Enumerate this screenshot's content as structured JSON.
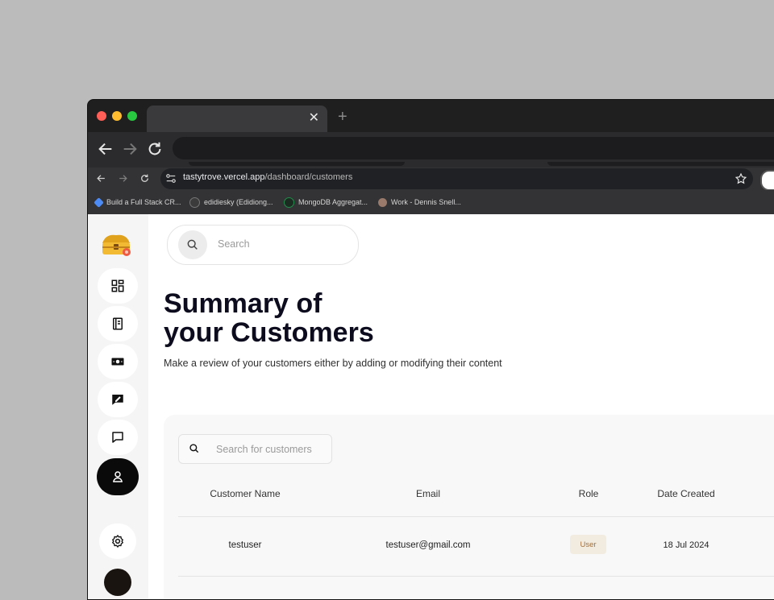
{
  "browser": {
    "tab_close_glyph": "✕",
    "new_tab_glyph": "+",
    "url_host": "tastytrove.vercel.app",
    "url_path": "/dashboard/customers",
    "bookmarks": [
      {
        "label": "Build a Full Stack CR...",
        "icon": "blue-diamond-icon",
        "color": "#4c8bf5"
      },
      {
        "label": "edidiesky (Edidiong...",
        "icon": "github-icon",
        "color": "#3b3b3b"
      },
      {
        "label": "MongoDB Aggregat...",
        "icon": "mongodb-leaf-icon",
        "color": "#1f8f4a"
      },
      {
        "label": "Work - Dennis Snell...",
        "icon": "user-photo-icon",
        "color": "#9a7a6a"
      }
    ]
  },
  "sidebar": {
    "items": [
      {
        "name": "dashboard",
        "icon": "dashboard-grid-icon"
      },
      {
        "name": "menu",
        "icon": "book-icon"
      },
      {
        "name": "payments",
        "icon": "money-icon"
      },
      {
        "name": "reviews",
        "icon": "message-edit-icon"
      },
      {
        "name": "messages",
        "icon": "chat-icon"
      },
      {
        "name": "customers",
        "icon": "user-icon",
        "active": true
      }
    ],
    "settings_icon": "gear-icon"
  },
  "header": {
    "search_placeholder": "Search"
  },
  "main": {
    "title_line1": "Summary of",
    "title_line2": "your Customers",
    "subtitle": "Make a review of your customers either by adding or modifying their content"
  },
  "table": {
    "search_placeholder": "Search for customers",
    "columns": [
      "Customer Name",
      "Email",
      "Role",
      "Date Created"
    ],
    "rows": [
      {
        "name": "testuser",
        "email": "testuser@gmail.com",
        "role": "User",
        "date": "18 Jul 2024"
      }
    ]
  },
  "colors": {
    "accent_dark": "#0a0a0a",
    "badge_bg": "#f2ebe0",
    "badge_text": "#a2703a",
    "page_bg": "#bbbbbb"
  }
}
